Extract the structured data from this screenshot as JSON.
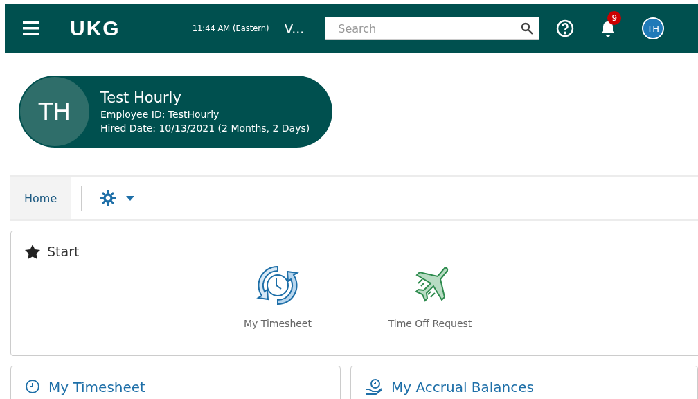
{
  "header": {
    "logo": "UKG",
    "time": "11:44 AM (Eastern)",
    "title": "V...",
    "search": {
      "placeholder": "Search"
    },
    "notifications": "9",
    "avatar": "TH"
  },
  "profile": {
    "initials": "TH",
    "name": "Test Hourly",
    "employee_id": "Employee ID: TestHourly",
    "hired": "Hired Date: 10/13/2021 (2 Months, 2 Days)"
  },
  "tabs": [
    {
      "label": "Home",
      "selected": true
    }
  ],
  "start": {
    "title": "Start",
    "tiles": [
      {
        "kind": "timesheet",
        "label": "My Timesheet"
      },
      {
        "kind": "timeoff",
        "label": "Time Off Request"
      }
    ]
  },
  "cards": [
    {
      "kind": "clock",
      "title": "My Timesheet"
    },
    {
      "kind": "accrual",
      "title": "My Accrual Balances"
    }
  ]
}
